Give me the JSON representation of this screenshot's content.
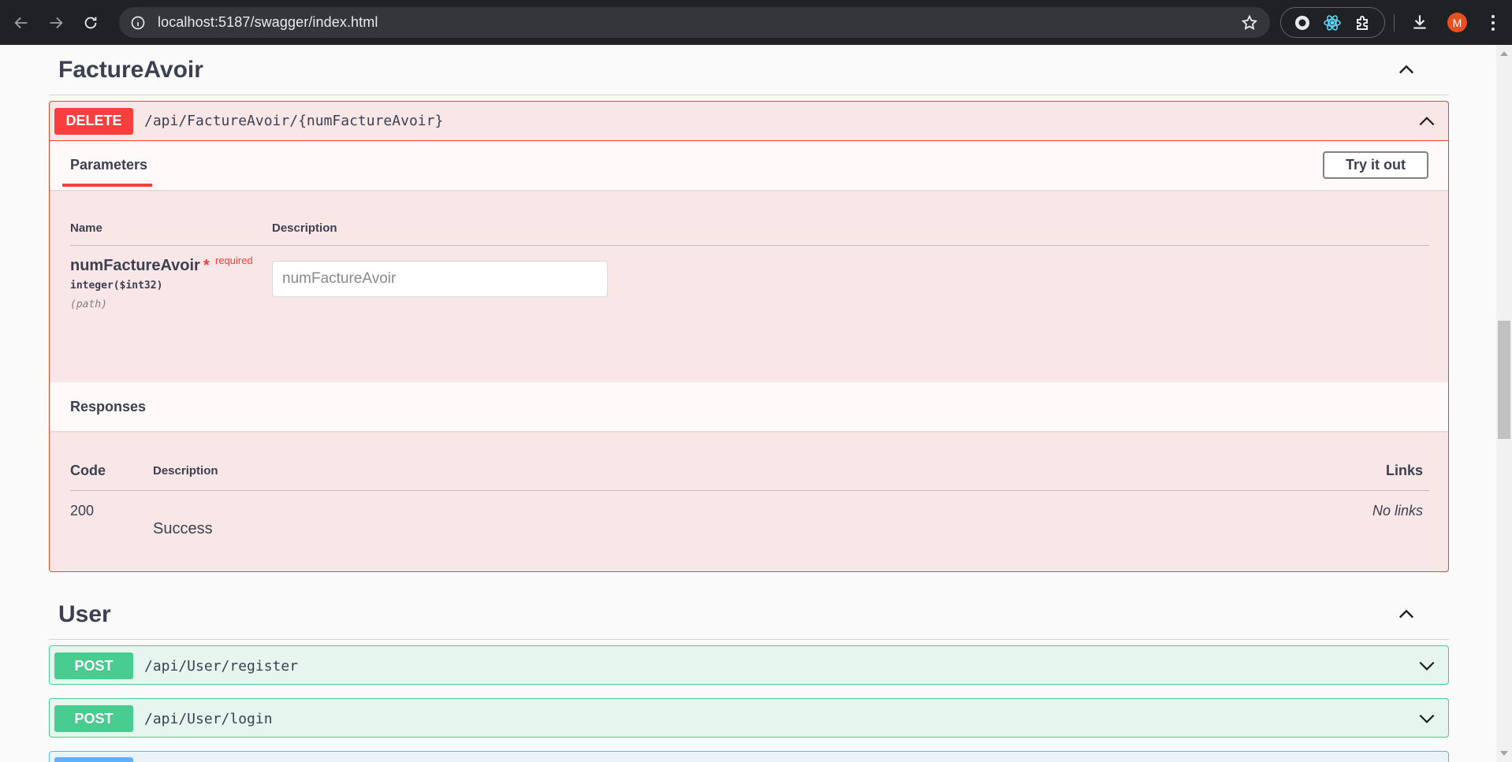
{
  "browser": {
    "url": "localhost:5187/swagger/index.html",
    "profile_initial": "M",
    "icons": [
      "back-arrow-icon",
      "forward-arrow-icon",
      "reload-icon",
      "site-info-icon",
      "bookmark-star-icon",
      "extension-icon",
      "react-devtools-icon",
      "puzzle-icon",
      "download-icon",
      "kebab-menu-icon"
    ]
  },
  "sections": {
    "facture": {
      "title": "FactureAvoir",
      "operation": {
        "method": "DELETE",
        "path": "/api/FactureAvoir/{numFactureAvoir}",
        "tab_label": "Parameters",
        "try_label": "Try it out",
        "params_header": {
          "name": "Name",
          "description": "Description"
        },
        "param": {
          "name": "numFactureAvoir",
          "star": "*",
          "required": "required",
          "type": "integer($int32)",
          "in": "(path)",
          "placeholder": "numFactureAvoir"
        },
        "responses_title": "Responses",
        "responses_header": {
          "code": "Code",
          "description": "Description",
          "links": "Links"
        },
        "response": {
          "code": "200",
          "description": "Success",
          "links": "No links"
        }
      }
    },
    "user": {
      "title": "User",
      "operations": [
        {
          "method": "POST",
          "path": "/api/User/register"
        },
        {
          "method": "POST",
          "path": "/api/User/login"
        }
      ]
    }
  },
  "colors": {
    "delete": "#f93e3e",
    "post": "#49cc90",
    "get": "#61affe",
    "text": "#3b4151"
  }
}
